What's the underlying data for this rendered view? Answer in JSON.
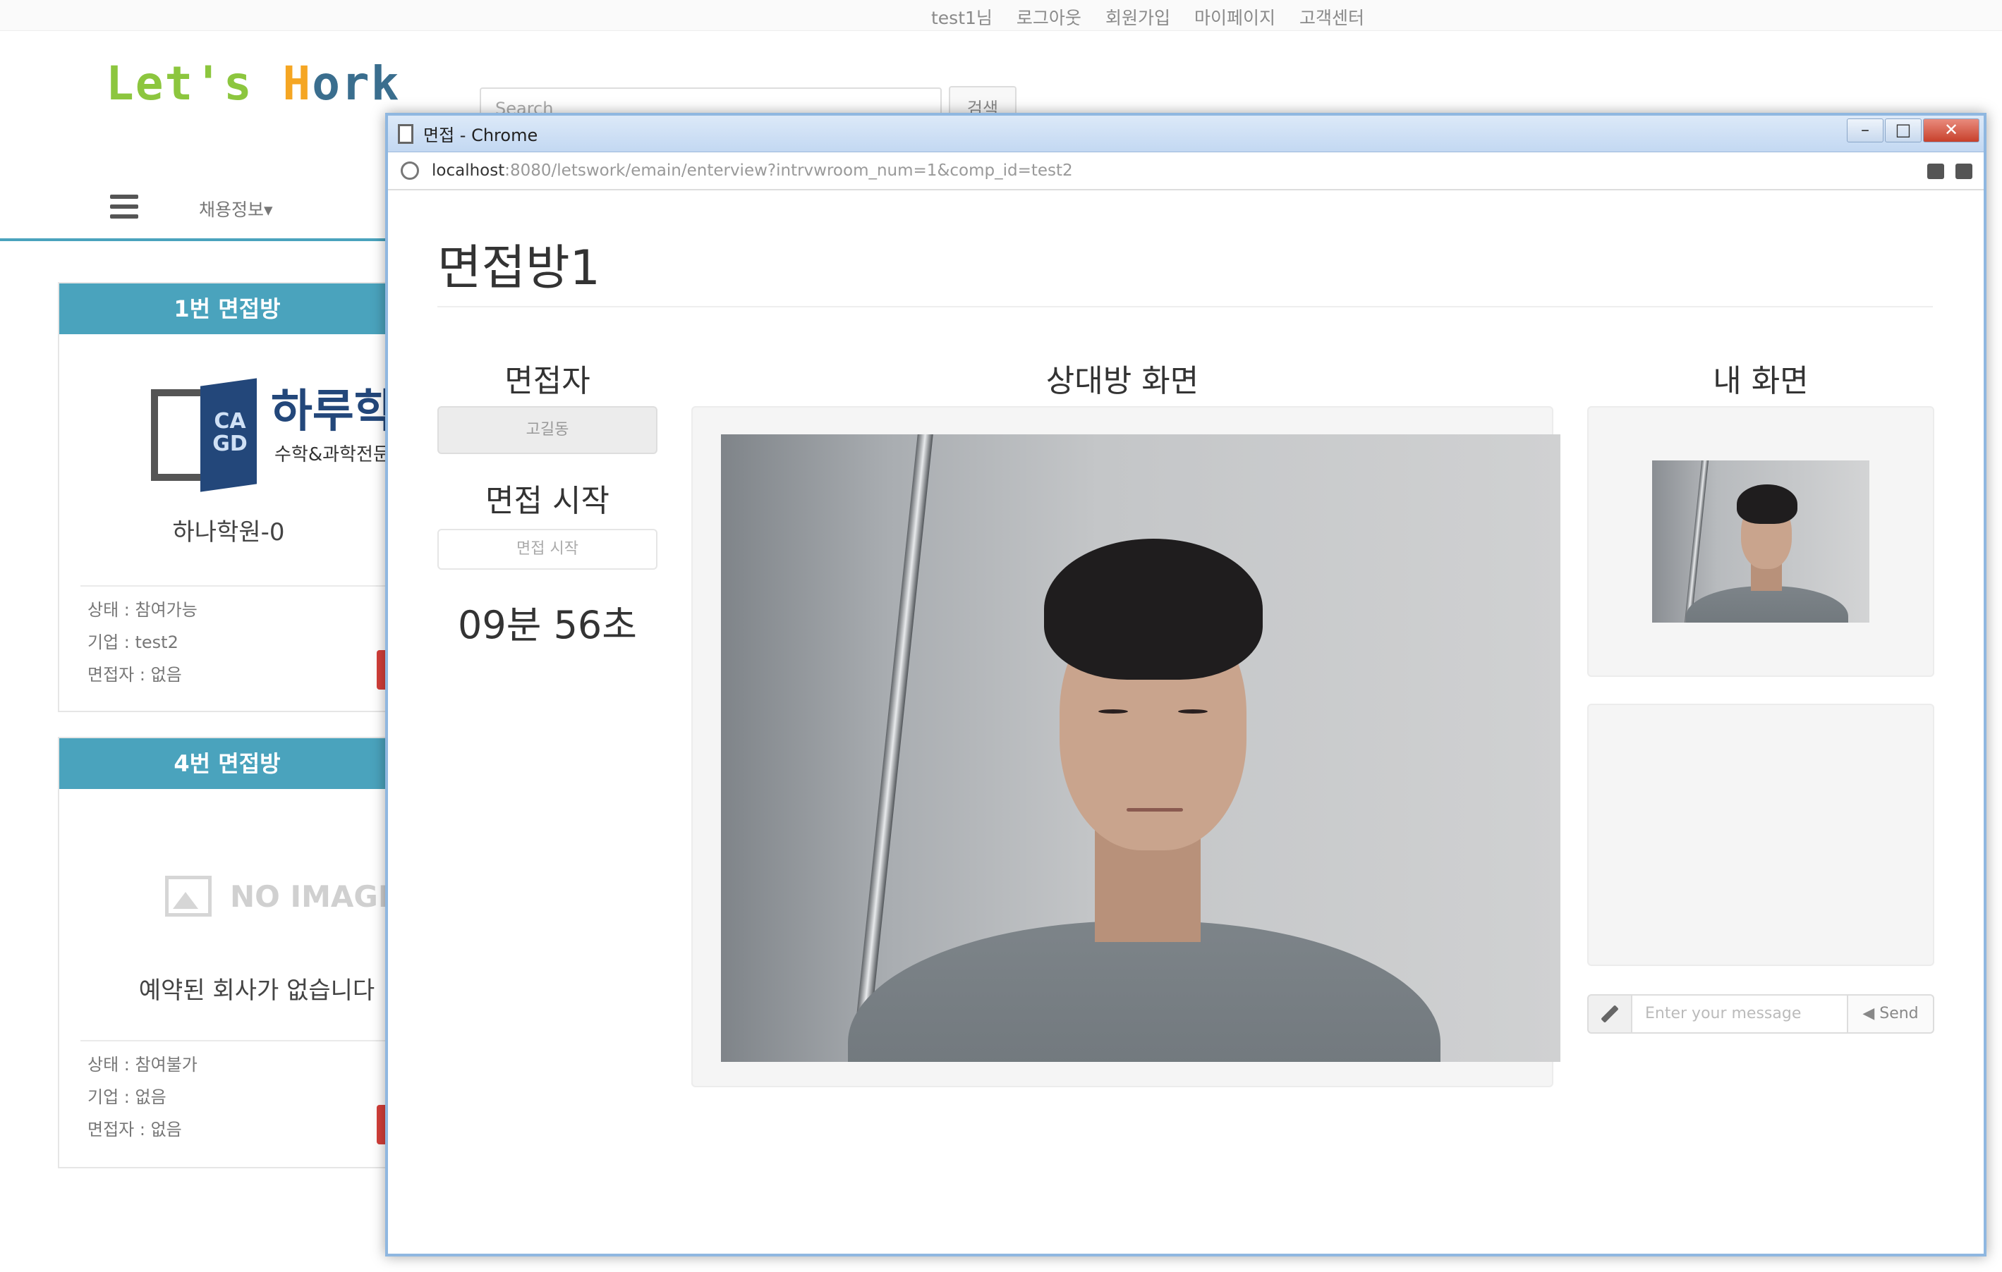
{
  "site": {
    "top_links": [
      "test1님",
      "로그아웃",
      "회원가입",
      "마이페이지",
      "고객센터"
    ],
    "logo": {
      "part1": "Let's",
      "part2": "H",
      "part3": "ork"
    },
    "search_placeholder": "Search",
    "search_button": "검색",
    "nav_menu": "채용정보▾"
  },
  "cards": [
    {
      "header": "1번 면접방",
      "logo_text": "하루학원",
      "logo_sub": "수학&과학전문",
      "logo_cover": "CA GD",
      "company": "하나학원-0",
      "status": "상태 : 참여가능",
      "company_id": "기업 : test2",
      "interviewer": "면접자 : 없음"
    },
    {
      "header": "4번 면접방",
      "no_image": "NO IMAGE",
      "company": "예약된 회사가 없습니다",
      "status": "상태 : 참여불가",
      "company_id": "기업 : 없음",
      "interviewer": "면접자 : 없음"
    }
  ],
  "popup": {
    "window_title": "면접 - Chrome",
    "url_host": "localhost",
    "url_rest": ":8080/letswork/emain/enterview?intrvwroom_num=1&comp_id=test2",
    "room_title": "면접방1",
    "interviewer_label": "면접자",
    "interviewer_name": "고길동",
    "start_label": "면접 시작",
    "start_button": "면접 시작",
    "timer": "09분 56초",
    "remote_label": "상대방 화면",
    "local_label": "내 화면",
    "chat_placeholder": "Enter your message",
    "send_button": "◀ Send"
  }
}
